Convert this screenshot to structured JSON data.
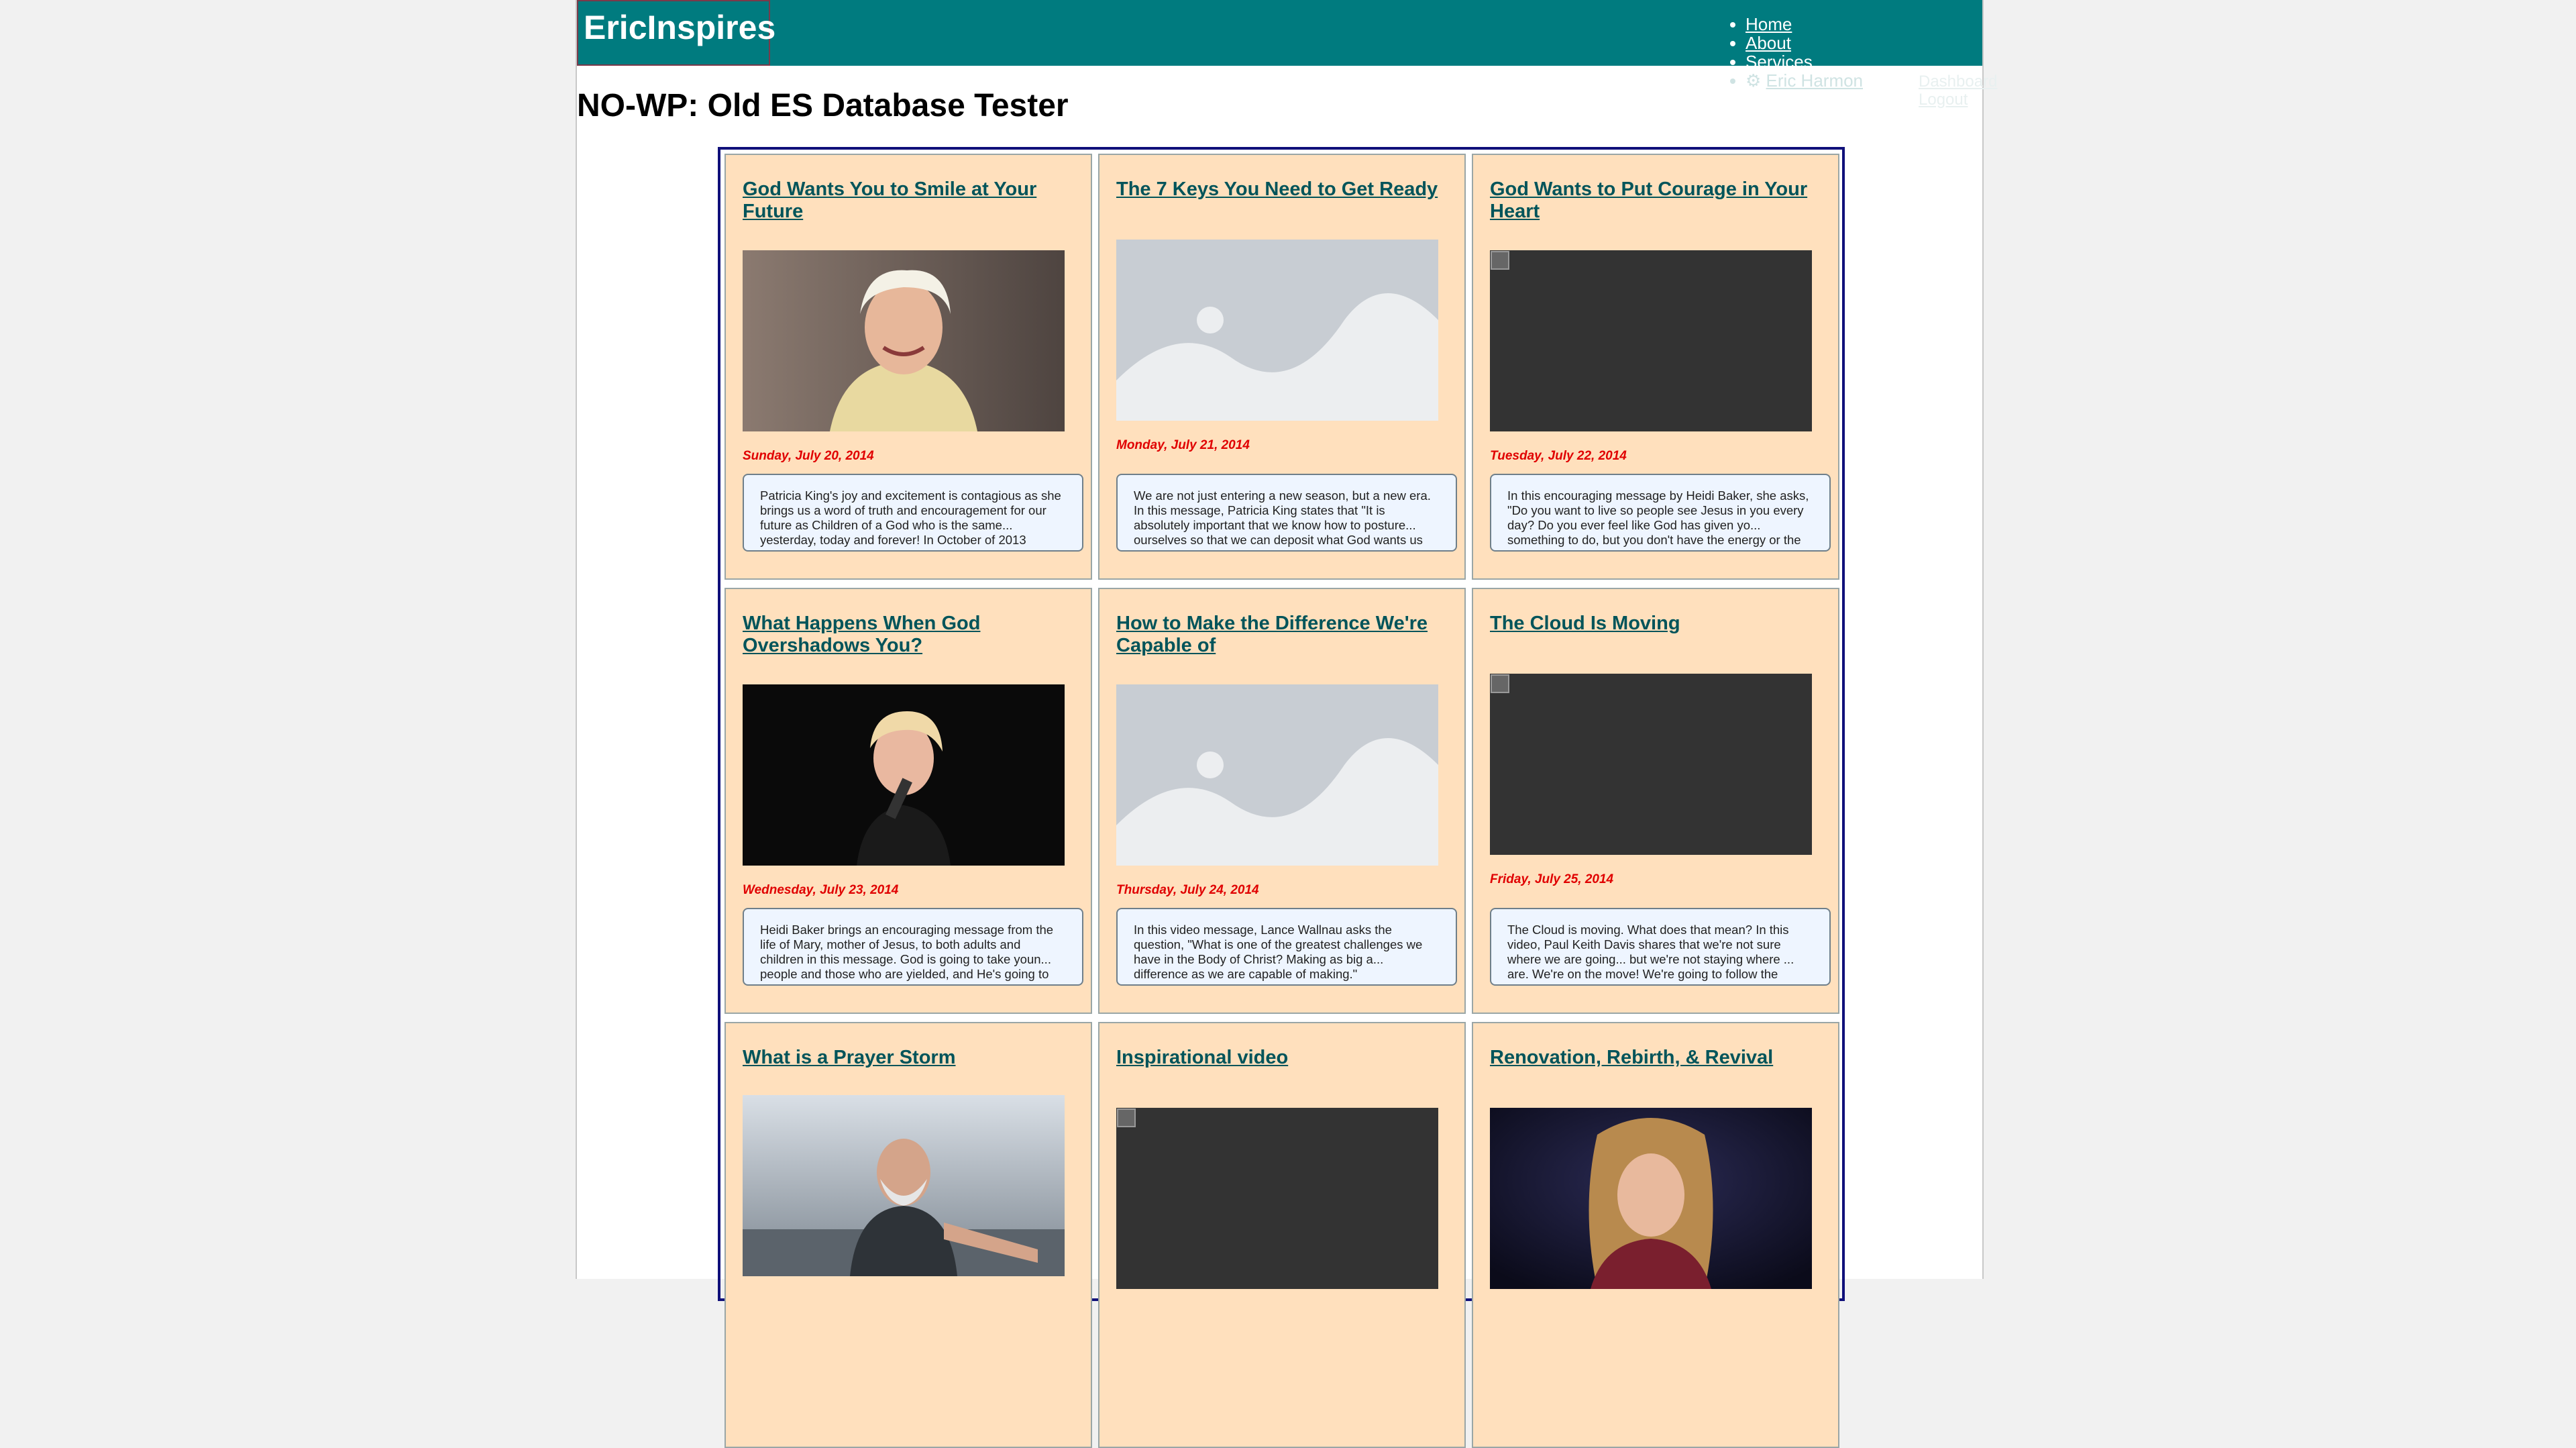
{
  "site": {
    "logo": "EricInspires",
    "nav": [
      {
        "label": "Home"
      },
      {
        "label": "About"
      },
      {
        "label": "Services"
      },
      {
        "label": "Eric Harmon"
      }
    ],
    "nav_extra": [
      "Dashboard",
      "Logout"
    ]
  },
  "page_title": "NO-WP: Old ES Database Tester",
  "colors": {
    "header": "#007b7f",
    "card_bg": "#ffe0bd",
    "title_link": "#00545a",
    "date": "#e00000",
    "grid_border": "#10107a"
  },
  "posts": [
    {
      "title": "God Wants You to Smile at Your Future",
      "date": "Sunday, July 20, 2014",
      "image": "photo-smiling-woman-blonde-icon",
      "excerpt": "Patricia King's joy and excitement is contagious as she brings us a word of truth and encouragement for our future as Children of a God who is the same... yesterday, today and forever! In October of 2013"
    },
    {
      "title": "The 7 Keys You Need to Get Ready",
      "date": "Monday, July 21, 2014",
      "image": "image-placeholder-icon",
      "excerpt": "We are not just entering a new season, but a new era. In this message, Patricia King states that \"It is absolutely important that we know how to posture... ourselves so that we can deposit what God wants us"
    },
    {
      "title": "God Wants to Put Courage in Your Heart",
      "date": "Tuesday, July 22, 2014",
      "image": "broken-image-icon",
      "excerpt": "In this encouraging message by Heidi Baker, she asks, \"Do you want to live so people see Jesus in you every day? Do you ever feel like God has given yo... something to do, but you don't have the energy or the"
    },
    {
      "title": "What Happens When God Overshadows You?",
      "date": "Wednesday, July 23, 2014",
      "image": "photo-woman-microphone-icon",
      "excerpt": "Heidi Baker brings an encouraging message from the life of Mary, mother of Jesus, to both adults and children in this message. God is going to take youn... people and those who are yielded, and He's going to"
    },
    {
      "title": "How to Make the Difference We're Capable of",
      "date": "Thursday, July 24, 2014",
      "image": "image-placeholder-icon",
      "excerpt": "In this video message, Lance Wallnau asks the question, \"What is one of the greatest challenges we have in the Body of Christ? Making as big a... difference as we are capable of making.\""
    },
    {
      "title": "The Cloud Is Moving",
      "date": "Friday, July 25, 2014",
      "image": "broken-image-icon",
      "excerpt": "The Cloud is moving. What does that mean? In this video, Paul Keith Davis shares that we're not sure where we are going... but we're not staying where ... are. We're on the move! We're going to follow the"
    },
    {
      "title": "What is a Prayer Storm",
      "date": "",
      "image": "photo-man-reaching-icon",
      "excerpt": ""
    },
    {
      "title": "Inspirational video",
      "date": "",
      "image": "broken-image-icon",
      "excerpt": ""
    },
    {
      "title": "Renovation, Rebirth, & Revival",
      "date": "",
      "image": "photo-woman-portrait-icon",
      "excerpt": ""
    }
  ]
}
